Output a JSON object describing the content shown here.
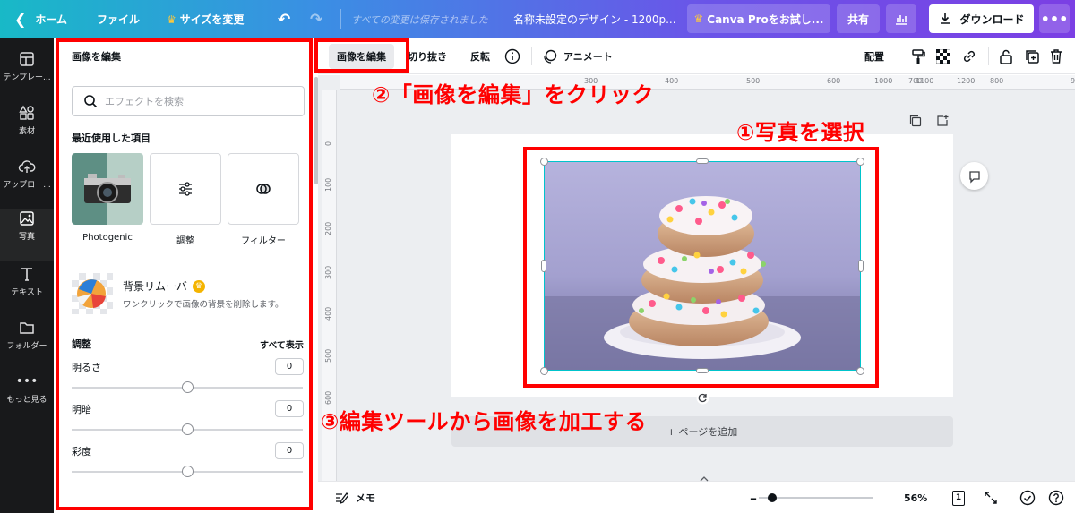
{
  "topbar": {
    "home": "ホーム",
    "file": "ファイル",
    "resize": "サイズを変更",
    "saved_status": "すべての変更は保存されました",
    "design_title": "名称未設定のデザイン - 1200p...",
    "pro_trial": "Canva Proをお試し...",
    "share": "共有",
    "download": "ダウンロード"
  },
  "rail": {
    "items": [
      {
        "label": "テンプレー..."
      },
      {
        "label": "素材"
      },
      {
        "label": "アップロー..."
      },
      {
        "label": "写真"
      },
      {
        "label": "テキスト"
      },
      {
        "label": "フォルダー"
      },
      {
        "label": "もっと見る"
      }
    ]
  },
  "panel": {
    "title": "画像を編集",
    "search_placeholder": "エフェクトを検索",
    "recent_heading": "最近使用した項目",
    "recent": [
      {
        "label": "Photogenic"
      },
      {
        "label": "調整"
      },
      {
        "label": "フィルター"
      }
    ],
    "bg_remover": {
      "title": "背景リムーバ",
      "desc": "ワンクリックで画像の背景を削除します。"
    },
    "adjust_heading": "調整",
    "show_all": "すべて表示",
    "sliders": [
      {
        "label": "明るさ",
        "value": "0"
      },
      {
        "label": "明暗",
        "value": "0"
      },
      {
        "label": "彩度",
        "value": "0"
      }
    ]
  },
  "toolbar": {
    "edit_image": "画像を編集",
    "crop": "切り抜き",
    "flip": "反転",
    "animate": "アニメート",
    "arrange": "配置"
  },
  "ruler": {
    "top": [
      "300",
      "400",
      "500",
      "600",
      "700",
      "800",
      "900",
      "1000",
      "1100",
      "1200"
    ],
    "left": [
      "0",
      "100",
      "200",
      "300",
      "400",
      "500",
      "600"
    ]
  },
  "canvas": {
    "add_page": "+ ページを追加"
  },
  "bottombar": {
    "notes": "メモ",
    "zoom": "56%",
    "page_num": "1",
    "zoom_level": 0.12
  },
  "annotations": {
    "step1": "①写真を選択",
    "step2": "②「画像を編集」をクリック",
    "step3": "③編集ツールから画像を加工する"
  },
  "colors": {
    "annotation_red": "#ff0000",
    "selection_cyan": "#00c4cc",
    "rail_bg": "#18191b"
  }
}
